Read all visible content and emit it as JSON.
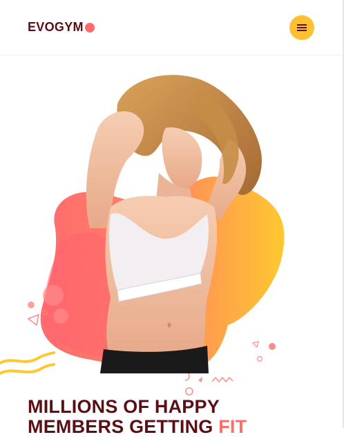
{
  "header": {
    "logo_text": "EVOGYM",
    "menu_icon": "hamburger-menu-icon"
  },
  "hero": {
    "image": "woman-fitness-model-illustration",
    "headline_line1": "MILLIONS OF HAPPY",
    "headline_line2_prefix": "MEMBERS GETTING ",
    "headline_line2_accent": "FIT"
  },
  "colors": {
    "brand_dark": "#5a0f14",
    "accent_coral": "#ff6b6b",
    "accent_yellow": "#ffc132"
  }
}
